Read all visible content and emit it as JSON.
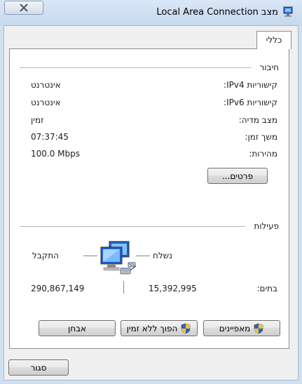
{
  "window": {
    "title": "מצב Local Area Connection",
    "close_tooltip": "Close"
  },
  "tabs": [
    {
      "label": "כללי",
      "selected": true
    }
  ],
  "connection": {
    "heading": "חיבור",
    "rows": [
      {
        "label": "קישוריות IPv4:",
        "value": "אינטרנט"
      },
      {
        "label": "קישוריות IPv6:",
        "value": "אינטרנט"
      },
      {
        "label": "מצב מדיה:",
        "value": "זמין"
      },
      {
        "label": "משך זמן:",
        "value": "07:37:45"
      },
      {
        "label": "מהירות:",
        "value": "100.0 Mbps"
      }
    ],
    "details_button": "פרטים..."
  },
  "activity": {
    "heading": "פעילות",
    "sent_label": "נשלח",
    "received_label": "התקבל",
    "bytes_label": "בתים:",
    "bytes_sent": "15,392,995",
    "bytes_received": "290,867,149"
  },
  "buttons": {
    "properties": "מאפיינים",
    "disable": "הפוך ללא זמין",
    "diagnose": "אבחן",
    "close": "סגור"
  },
  "icons": {
    "app": "network-connection-icon",
    "shield": "uac-shield-icon",
    "computer": "network-computers-icon"
  },
  "colors": {
    "frame": "#cfe0f3",
    "panel": "#ffffff",
    "dialog": "#f0f0f0"
  }
}
